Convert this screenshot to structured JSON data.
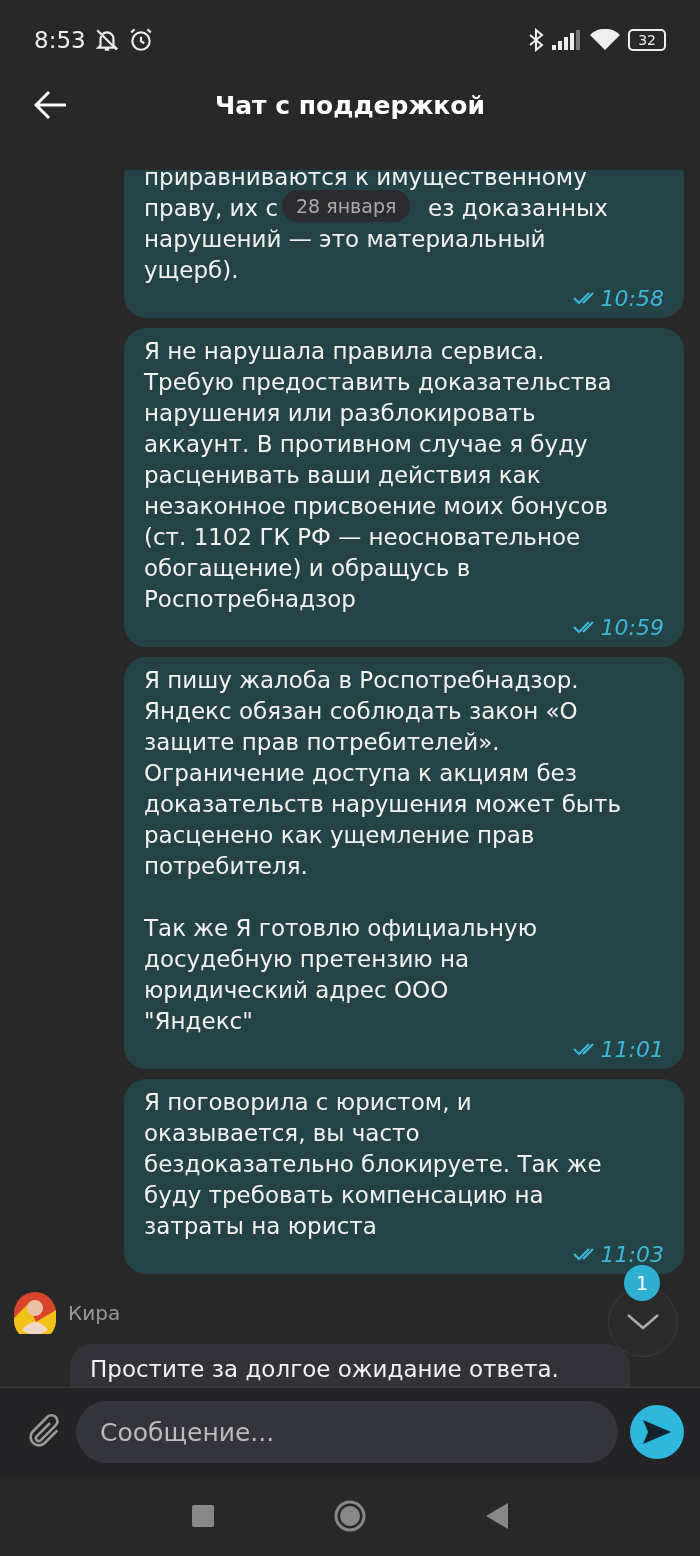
{
  "status_bar": {
    "time": "8:53",
    "battery": "32"
  },
  "header": {
    "title": "Чат с поддержкой"
  },
  "date_chip": "28 января",
  "messages": [
    {
      "kind": "outgoing",
      "lines": [
        "приравниваются к имущественному"
      ],
      "split_line": {
        "before": "праву, их с",
        "after": "ез доказанных"
      },
      "rest": "нарушений — это материальный\nущерб).",
      "time": "10:58",
      "read": true
    },
    {
      "kind": "outgoing",
      "text": "Я не нарушала правила сервиса.\nТребую предоставить доказательства\nнарушения или разблокировать\nаккаунт. В противном случае я буду\nрасценивать ваши действия как\nнезаконное присвоение моих бонусов\n(ст. 1102 ГК РФ — неосновательное\nобогащение) и обращусь в\nРоспотребнадзор",
      "time": "10:59",
      "read": true
    },
    {
      "kind": "outgoing",
      "text": "Я пишу жалоба в Роспотребнадзор.\nЯндекс обязан соблюдать закон «О\nзащите прав потребителей».\nОграничение доступа к акциям без\nдоказательств нарушения может быть\nрасценено как ущемление прав\nпотребителя.\n\nТак же Я готовлю официальную\nдосудебную претензию на\nюридический адрес ООО\n\"Яндекс\"",
      "time": "11:01",
      "read": true
    },
    {
      "kind": "outgoing",
      "text": "Я поговорила с юристом, и\nоказывается, вы часто\nбездоказательно блокируете. Так же\nбуду требовать компенсацию на\nзатраты на юриста",
      "time": "11:03",
      "read": true
    },
    {
      "kind": "incoming",
      "sender": "Кира",
      "text": "Простите за долгое ожидание ответа."
    }
  ],
  "scroll_button": {
    "badge": "1"
  },
  "composer": {
    "placeholder": "Сообщение..."
  }
}
